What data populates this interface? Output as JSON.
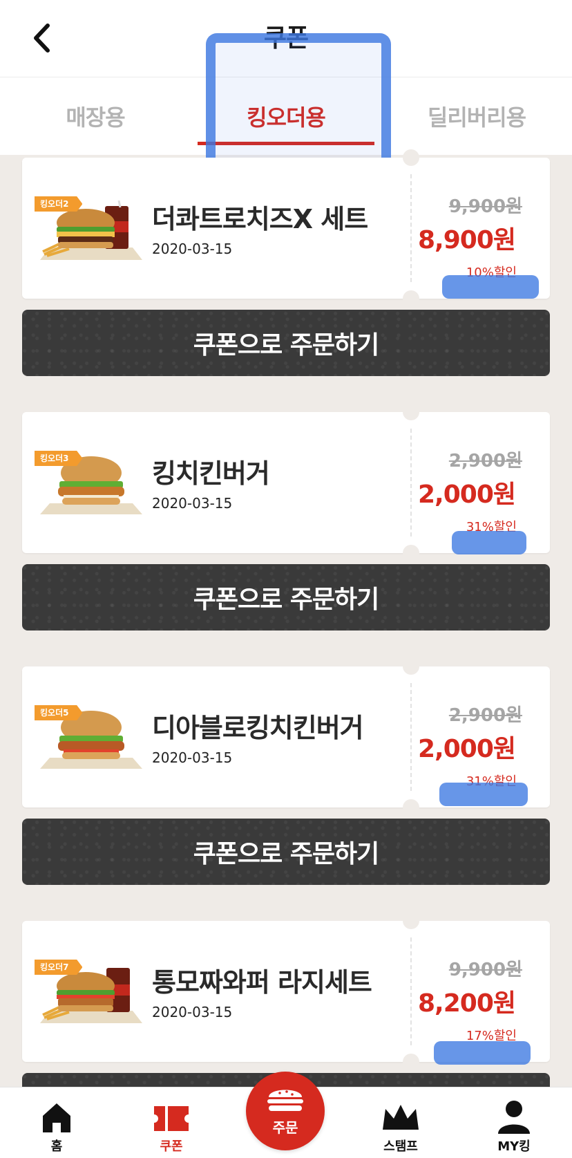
{
  "header": {
    "title": "쿠폰",
    "back_icon": "chevron-left-icon"
  },
  "tabs": [
    {
      "label": "매장용",
      "active": false
    },
    {
      "label": "킹오더용",
      "active": true
    },
    {
      "label": "딜리버리용",
      "active": false
    }
  ],
  "coupons": [
    {
      "badge": "킹오더2",
      "name": "더콰트로치즈X 세트",
      "date": "2020-03-15",
      "original_price": "9,900원",
      "sale_price": "8,900원",
      "discount": "10%할인",
      "image": "burger-set-image",
      "order_label": "쿠폰으로 주문하기"
    },
    {
      "badge": "킹오더3",
      "name": "킹치킨버거",
      "date": "2020-03-15",
      "original_price": "2,900원",
      "sale_price": "2,000원",
      "discount": "31%할인",
      "image": "chicken-burger-image",
      "order_label": "쿠폰으로 주문하기"
    },
    {
      "badge": "킹오더5",
      "name": "디아블로킹치킨버거",
      "date": "2020-03-15",
      "original_price": "2,900원",
      "sale_price": "2,000원",
      "discount": "31%할인",
      "image": "chicken-burger-image",
      "order_label": "쿠폰으로 주문하기"
    },
    {
      "badge": "킹오더7",
      "name": "통모짜와퍼 라지세트",
      "date": "2020-03-15",
      "original_price": "9,900원",
      "sale_price": "8,200원",
      "discount": "17%할인",
      "image": "burger-set-image",
      "order_label": "쿠폰으로 주문하기"
    }
  ],
  "bottom_nav": [
    {
      "label": "홈",
      "icon": "home-icon",
      "active": false
    },
    {
      "label": "쿠폰",
      "icon": "coupon-icon",
      "active": true
    },
    {
      "label": "주문",
      "icon": "burger-icon",
      "active": false
    },
    {
      "label": "스탬프",
      "icon": "crown-icon",
      "active": false
    },
    {
      "label": "MY킹",
      "icon": "person-icon",
      "active": false
    }
  ],
  "colors": {
    "brand_red": "#d52a1f",
    "badge_orange": "#f39b2d",
    "button_dark": "#3a3a3a",
    "background": "#efebe7",
    "annotation_blue": "#3c78e1"
  }
}
